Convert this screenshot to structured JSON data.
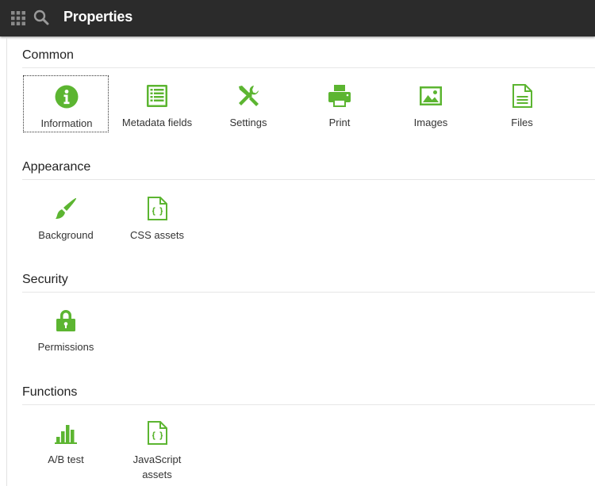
{
  "header": {
    "title": "Properties",
    "apps_icon": "apps-grid-icon",
    "search_icon": "search-icon"
  },
  "colors": {
    "topbar": "#2b2b2b",
    "icon_green": "#5cb531",
    "divider": "#e6e6e6"
  },
  "sections": [
    {
      "title": "Common",
      "items": [
        {
          "label": "Information",
          "icon": "info-icon",
          "selected": true
        },
        {
          "label": "Metadata fields",
          "icon": "list-icon"
        },
        {
          "label": "Settings",
          "icon": "tools-icon"
        },
        {
          "label": "Print",
          "icon": "printer-icon"
        },
        {
          "label": "Images",
          "icon": "image-icon"
        },
        {
          "label": "Files",
          "icon": "file-icon"
        }
      ]
    },
    {
      "title": "Appearance",
      "items": [
        {
          "label": "Background",
          "icon": "brush-icon"
        },
        {
          "label": "CSS assets",
          "icon": "code-file-icon"
        }
      ]
    },
    {
      "title": "Security",
      "items": [
        {
          "label": "Permissions",
          "icon": "lock-icon"
        }
      ]
    },
    {
      "title": "Functions",
      "items": [
        {
          "label": "A/B test",
          "icon": "bar-chart-icon"
        },
        {
          "label": "JavaScript assets",
          "icon": "code-file-icon"
        }
      ]
    }
  ]
}
